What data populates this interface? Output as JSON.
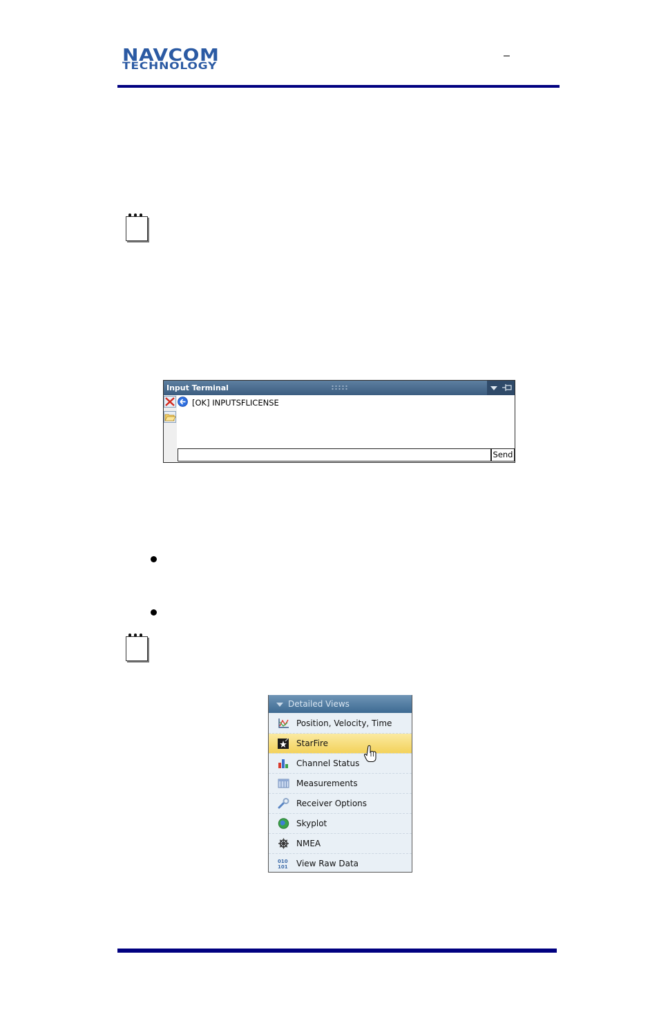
{
  "header": {
    "logo_line1": "NAVCOM",
    "logo_line2": "TECHNOLOGY",
    "dash": "–",
    "colors": {
      "rule": "#000080",
      "logo": "#2b5aa3"
    }
  },
  "notes": [
    {
      "icon": "notepad-icon"
    },
    {
      "icon": "notepad-icon"
    }
  ],
  "terminal": {
    "title": "Input Terminal",
    "output_lines": [
      "[OK] INPUTSFLICENSE"
    ],
    "input_value": "",
    "send_label": "Send",
    "icons": [
      "clear-icon",
      "open-folder-icon",
      "back-arrow-icon",
      "dropdown-icon",
      "pin-icon"
    ]
  },
  "bullets": [
    "",
    ""
  ],
  "detailed_views": {
    "title": "Detailed Views",
    "items": [
      {
        "label": "Position, Velocity, Time",
        "icon": "pvt-chart-icon",
        "selected": false
      },
      {
        "label": "StarFire",
        "icon": "starfire-icon",
        "selected": true
      },
      {
        "label": "Channel Status",
        "icon": "bar-chart-icon",
        "selected": false
      },
      {
        "label": "Measurements",
        "icon": "table-icon",
        "selected": false
      },
      {
        "label": "Receiver Options",
        "icon": "wrench-icon",
        "selected": false
      },
      {
        "label": "Skyplot",
        "icon": "globe-icon",
        "selected": false
      },
      {
        "label": "NMEA",
        "icon": "ship-wheel-icon",
        "selected": false
      },
      {
        "label": "View Raw Data",
        "icon": "binary-icon",
        "selected": false
      }
    ],
    "colors": {
      "selected": "#f3d25b",
      "header": "#4a7399"
    }
  }
}
